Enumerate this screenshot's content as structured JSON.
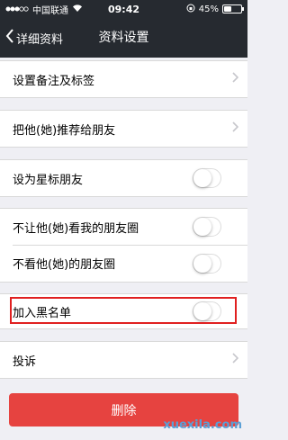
{
  "status_bar": {
    "carrier": "中国联通",
    "time": "09:42",
    "battery_percent": "45%",
    "battery_level": 0.45
  },
  "nav": {
    "back_label": "详细资料",
    "title": "资料设置"
  },
  "rows": {
    "remark": "设置备注及标签",
    "recommend": "把他(她)推荐给朋友",
    "star": "设为星标朋友",
    "hide_my_moments": "不让他(她)看我的朋友圈",
    "hide_their_moments": "不看他(她)的朋友圈",
    "blacklist": "加入黑名单",
    "report": "投诉"
  },
  "toggles": {
    "star": false,
    "hide_my_moments": false,
    "hide_their_moments": false,
    "blacklist": false
  },
  "delete_label": "删除",
  "watermark": "xuexila.com"
}
